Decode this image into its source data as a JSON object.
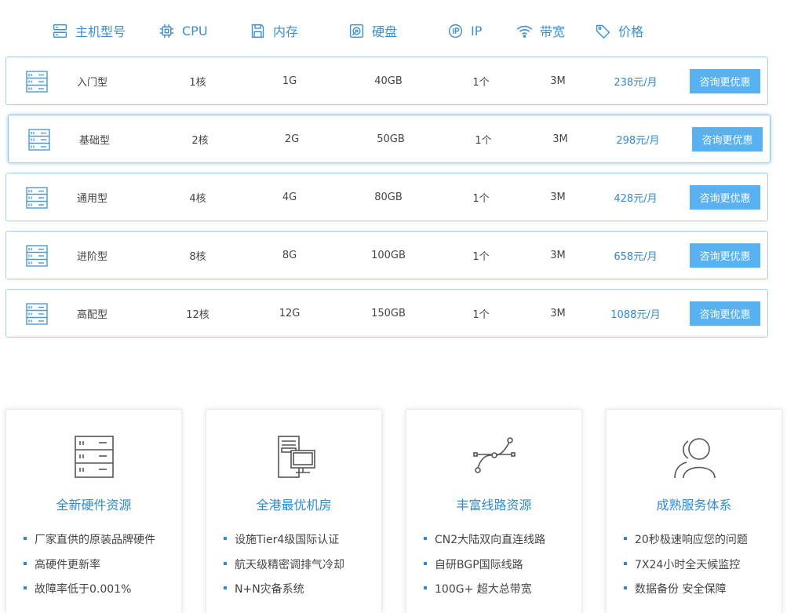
{
  "header": {
    "model_label": "主机型号",
    "cpu_label": "CPU",
    "memory_label": "内存",
    "disk_label": "硬盘",
    "ip_label": "IP",
    "bandwidth_label": "带宽",
    "price_label": "价格"
  },
  "plans": [
    {
      "name": "入门型",
      "cpu": "1核",
      "memory": "1G",
      "disk": "40GB",
      "ip": "1个",
      "bandwidth": "3M",
      "price": "238元/月",
      "button": "咨询更优惠"
    },
    {
      "name": "基础型",
      "cpu": "2核",
      "memory": "2G",
      "disk": "50GB",
      "ip": "1个",
      "bandwidth": "3M",
      "price": "298元/月",
      "button": "咨询更优惠"
    },
    {
      "name": "通用型",
      "cpu": "4核",
      "memory": "4G",
      "disk": "80GB",
      "ip": "1个",
      "bandwidth": "3M",
      "price": "428元/月",
      "button": "咨询更优惠"
    },
    {
      "name": "进阶型",
      "cpu": "8核",
      "memory": "8G",
      "disk": "100GB",
      "ip": "1个",
      "bandwidth": "3M",
      "price": "658元/月",
      "button": "咨询更优惠"
    },
    {
      "name": "高配型",
      "cpu": "12核",
      "memory": "12G",
      "disk": "150GB",
      "ip": "1个",
      "bandwidth": "3M",
      "price": "1088元/月",
      "button": "咨询更优惠"
    }
  ],
  "features": [
    {
      "icon": "server-rack-icon",
      "title": "全新硬件资源",
      "items": [
        "厂家直供的原装品牌硬件",
        "高硬件更新率",
        "故障率低于0.001%"
      ]
    },
    {
      "icon": "computer-room-icon",
      "title": "全港最优机房",
      "items": [
        "设施Tier4级国际认证",
        "航天级精密调排气冷却",
        "N+N灾备系统"
      ]
    },
    {
      "icon": "route-line-icon",
      "title": "丰富线路资源",
      "items": [
        "CN2大陆双向直连线路",
        "自研BGP国际线路",
        "100G+ 超大总带宽"
      ]
    },
    {
      "icon": "users-icon",
      "title": "成熟服务体系",
      "items": [
        "20秒极速响应您的问题",
        "7X24小时全天候监控",
        "数据备份 安全保障"
      ]
    }
  ],
  "colors": {
    "accent": "#2f8ad2",
    "button": "#5ab1f0",
    "row_border": "#9fcdee"
  }
}
